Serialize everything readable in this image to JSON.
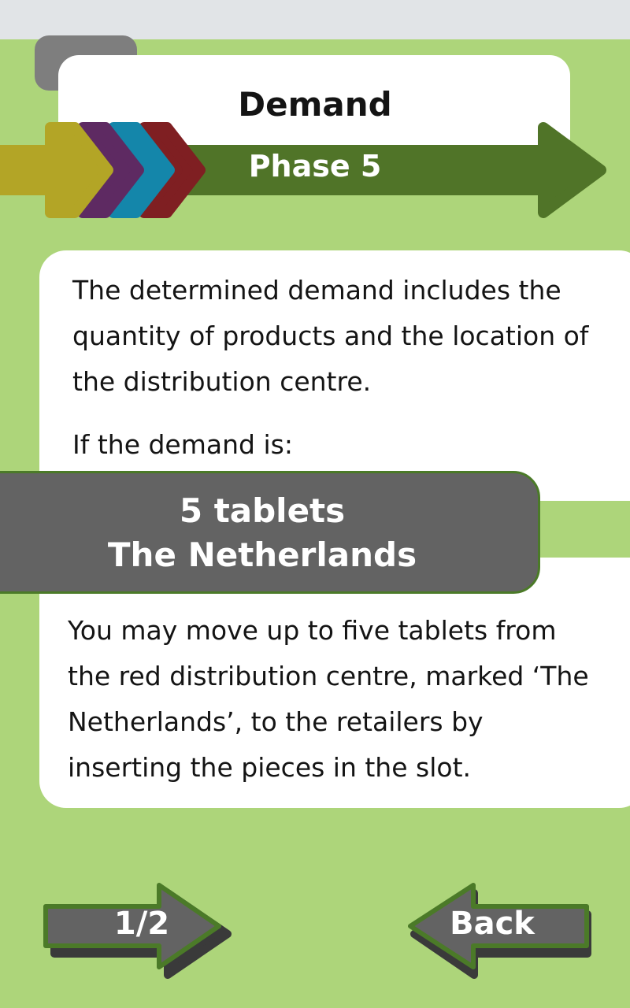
{
  "header": {
    "title": "Demand",
    "phase": "Phase 5"
  },
  "content": {
    "paragraph1": "The determined demand includes the quantity of products and the location of the distribution centre.",
    "paragraph2": "If the demand is:",
    "demand": {
      "quantity": "5 tablets",
      "location": "The Netherlands"
    },
    "paragraph3": "You may move up to five tablets from the red distribution centre, marked ‘The Netherlands’, to the retailers by inserting the pieces in the slot."
  },
  "navigation": {
    "page_indicator": "1/2",
    "back_label": "Back"
  },
  "colors": {
    "background": "#add57a",
    "phase_arrow_green": "#507428",
    "chevron_yellow": "#b3a526",
    "chevron_purple": "#5e2a62",
    "chevron_blue": "#1486aa",
    "chevron_red": "#7f1f22",
    "demand_box": "#636363",
    "button": "#636363"
  }
}
